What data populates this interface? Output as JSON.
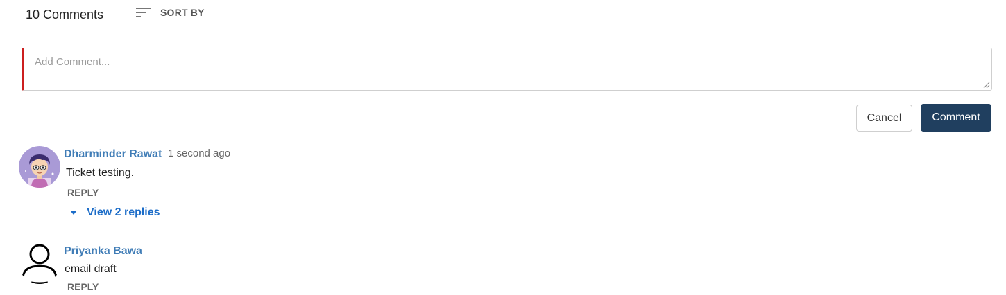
{
  "header": {
    "count_label": "10 Comments",
    "sort_label": "SORT BY"
  },
  "composer": {
    "placeholder": "Add Comment...",
    "cancel_label": "Cancel",
    "submit_label": "Comment",
    "accent_color": "#cc1f1f"
  },
  "comments": [
    {
      "author": "Dharminder Rawat",
      "time": "1 second ago",
      "text": "Ticket testing.",
      "reply_label": "REPLY",
      "replies_label": "View 2 replies"
    },
    {
      "author": "Priyanka Bawa",
      "text": "email draft",
      "reply_label": "REPLY"
    }
  ],
  "colors": {
    "link": "#3f7cb6",
    "primary_button": "#203f5f",
    "replies_link": "#1b6cc8"
  }
}
